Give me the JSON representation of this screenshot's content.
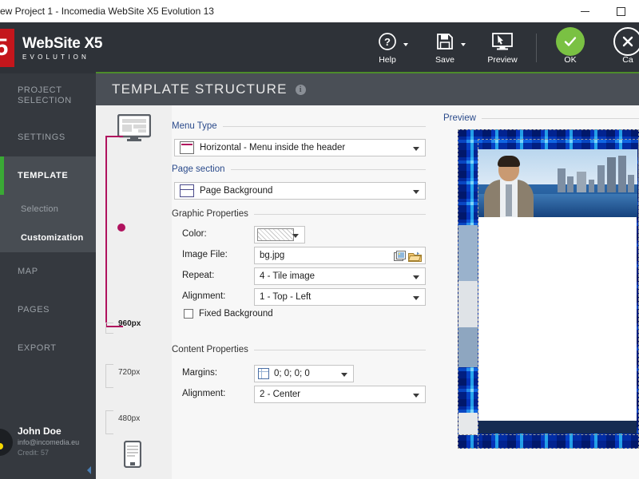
{
  "window": {
    "title": "ew Project 1 - Incomedia WebSite X5 Evolution 13",
    "minimize_label": "",
    "maximize_label": ""
  },
  "brand": {
    "mark": "5",
    "title": "WebSite X5",
    "subtitle": "EVOLUTION"
  },
  "header_actions": [
    {
      "name": "help",
      "label": "Help",
      "icon": "question-circle-icon",
      "has_caret": true
    },
    {
      "name": "save",
      "label": "Save",
      "icon": "floppy-disk-icon",
      "has_caret": true
    },
    {
      "name": "preview",
      "label": "Preview",
      "icon": "monitor-cursor-icon",
      "has_caret": false
    }
  ],
  "confirm_actions": [
    {
      "name": "ok",
      "label": "OK",
      "icon": "check-icon",
      "color": "#7ac143"
    },
    {
      "name": "cancel",
      "label": "Ca",
      "icon": "close-icon",
      "color": "#2e3238"
    }
  ],
  "sidebar": {
    "items": [
      {
        "id": "project-selection",
        "label": "PROJECT\nSELECTION",
        "line1": "PROJECT",
        "line2": "SELECTION",
        "active": false
      },
      {
        "id": "settings",
        "label": "SETTINGS",
        "active": false
      },
      {
        "id": "template",
        "label": "TEMPLATE",
        "active": true
      },
      {
        "id": "map",
        "label": "MAP",
        "active": false
      },
      {
        "id": "pages",
        "label": "PAGES",
        "active": false
      },
      {
        "id": "export",
        "label": "EXPORT",
        "active": false
      }
    ],
    "subitems": [
      {
        "id": "selection",
        "label": "Selection",
        "selected": false
      },
      {
        "id": "customization",
        "label": "Customization",
        "selected": true
      }
    ],
    "user": {
      "name": "John Doe",
      "email": "info@incomedia.eu",
      "credit": "Credit: 57"
    },
    "accent_color": "#3aa935"
  },
  "panel": {
    "title": "TEMPLATE STRUCTURE",
    "info_glyph": "i"
  },
  "ruler": {
    "desktop_icon": "desktop-monitor-icon",
    "mobile_icon": "mobile-phone-icon",
    "accent_color": "#b0125e",
    "ticks": [
      {
        "label": "960px",
        "bold": true
      },
      {
        "label": "720px",
        "bold": false
      },
      {
        "label": "480px",
        "bold": false
      }
    ]
  },
  "form": {
    "menu_type": {
      "group_label": "Menu Type",
      "value": "Horizontal - Menu inside the header"
    },
    "page_section": {
      "group_label": "Page section",
      "value": "Page Background"
    },
    "graphic_properties": {
      "group_label": "Graphic Properties",
      "color_label": "Color:",
      "color_value": "",
      "image_file_label": "Image File:",
      "image_file_value": "bg.jpg",
      "repeat_label": "Repeat:",
      "repeat_value": "4 - Tile image",
      "alignment_label": "Alignment:",
      "alignment_value": "1 - Top - Left",
      "fixed_background_label": "Fixed Background",
      "fixed_background_checked": false
    },
    "content_properties": {
      "group_label": "Content Properties",
      "margins_label": "Margins:",
      "margins_value": "0; 0; 0; 0",
      "alignment_label": "Alignment:",
      "alignment_value": "2 - Center"
    }
  },
  "preview": {
    "group_label": "Preview"
  },
  "colors": {
    "app_header_bg": "#2e3238",
    "sidebar_bg": "#35393f",
    "panel_header_bg": "#4a4f56",
    "content_bg": "#f7f7f7",
    "accent_green": "#7ac143",
    "accent_magenta": "#b0125e",
    "link_blue": "#2a4a8b",
    "brand_red": "#c4161c"
  }
}
